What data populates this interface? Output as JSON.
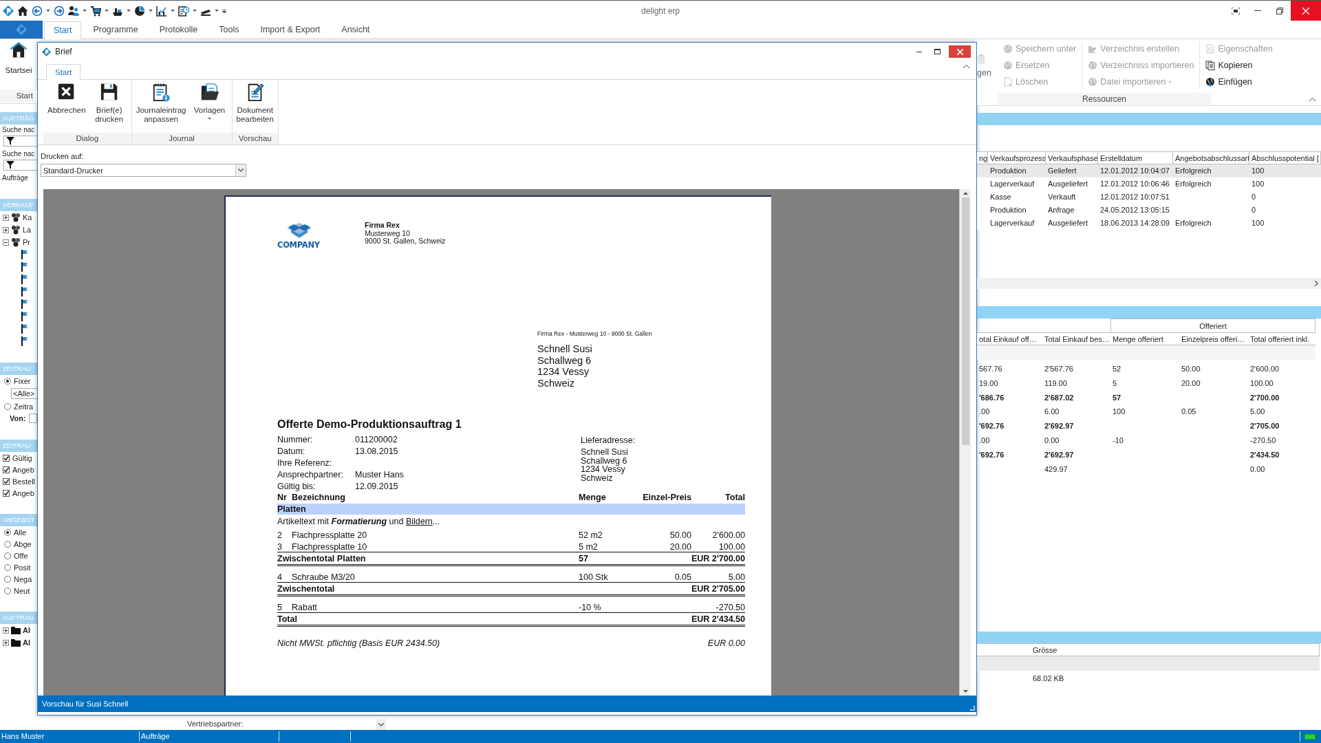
{
  "app": {
    "title": "delight erp"
  },
  "ribbon_tabs": [
    {
      "label": "Start",
      "selected": true
    },
    {
      "label": "Programme",
      "selected": false
    },
    {
      "label": "Protokolle",
      "selected": false
    },
    {
      "label": "Tools",
      "selected": false
    },
    {
      "label": "Import & Export",
      "selected": false
    },
    {
      "label": "Ansicht",
      "selected": false
    }
  ],
  "left_panel": {
    "ribbon_button": "Startsei",
    "ribbon_group": "Start",
    "items": [
      {
        "kind": "header",
        "text": "AUFTRÄG"
      },
      {
        "kind": "label",
        "text": "Suche nac"
      },
      {
        "kind": "filter"
      },
      {
        "kind": "label",
        "text": "Suche nac"
      },
      {
        "kind": "filter"
      },
      {
        "kind": "label",
        "text": "Aufträge"
      },
      {
        "kind": "header",
        "text": "VERKAUF"
      },
      {
        "kind": "tree",
        "text": "Ka",
        "expanded": false
      },
      {
        "kind": "tree",
        "text": "La",
        "expanded": false
      },
      {
        "kind": "tree",
        "text": "Pr",
        "expanded": true,
        "children": [
          {
            "kind": "flag"
          },
          {
            "kind": "flag"
          },
          {
            "kind": "flag"
          },
          {
            "kind": "flag"
          },
          {
            "kind": "flag"
          },
          {
            "kind": "flag"
          },
          {
            "kind": "flag"
          },
          {
            "kind": "flag"
          }
        ]
      },
      {
        "kind": "header",
        "text": "ZEITRAU"
      },
      {
        "kind": "radio",
        "text": "Fixer",
        "selected": true
      },
      {
        "kind": "dropdown",
        "text": "<Alle>"
      },
      {
        "kind": "radio",
        "text": "Zeitra",
        "selected": false
      },
      {
        "kind": "field",
        "text": "Von:"
      },
      {
        "kind": "header",
        "text": "ZEITRAU"
      },
      {
        "kind": "checkbox",
        "text": "Gültig",
        "checked": true
      },
      {
        "kind": "checkbox",
        "text": "Angeb",
        "checked": true
      },
      {
        "kind": "checkbox",
        "text": "Bestell",
        "checked": true
      },
      {
        "kind": "checkbox",
        "text": "Angeb",
        "checked": true
      },
      {
        "kind": "header",
        "text": "ANGEBOT"
      },
      {
        "kind": "radio",
        "text": "Alle",
        "selected": true
      },
      {
        "kind": "radio",
        "text": "Abge",
        "selected": false
      },
      {
        "kind": "radio",
        "text": "Offe",
        "selected": false
      },
      {
        "kind": "radio",
        "text": "Posit",
        "selected": false
      },
      {
        "kind": "radio",
        "text": "Nega",
        "selected": false
      },
      {
        "kind": "radio",
        "text": "Neut",
        "selected": false
      },
      {
        "kind": "header",
        "text": "AUFTRAG"
      },
      {
        "kind": "folder",
        "text": "Al",
        "expanded": false
      },
      {
        "kind": "folder",
        "text": "Al",
        "expanded": false
      }
    ]
  },
  "dialog": {
    "title": "Brief",
    "ribbon_tabs": [
      {
        "label": "Start",
        "selected": true
      }
    ],
    "ribbon_groups": [
      {
        "label": "Dialog",
        "buttons": [
          {
            "kind": "cancel",
            "label": "Abbrechen"
          },
          {
            "kind": "print",
            "label": "Brief(e) drucken"
          }
        ]
      },
      {
        "label": "Journal",
        "buttons": [
          {
            "kind": "journal",
            "label": "Journaleintrag anpassen"
          },
          {
            "kind": "templates",
            "label": "Vorlagen",
            "dropdown": true
          }
        ]
      },
      {
        "label": "Vorschau",
        "buttons": [
          {
            "kind": "edit",
            "label": "Dokument bearbeiten"
          }
        ]
      }
    ],
    "print_target": {
      "label": "Drucken auf:",
      "value": "Standard-Drucker"
    },
    "document": {
      "logo_text": "COMPANY",
      "company": [
        "Firma Rex",
        "Musterweg 10",
        "9000 St. Gallen, Schweiz"
      ],
      "sender_line": "Firma Rex - Musterweg 10 - 9000 St. Gallen",
      "recipient": [
        "Schnell Susi",
        "Schallweg 6",
        "1234 Vessy",
        "Schweiz"
      ],
      "title": "Offerte Demo-Produktionsauftrag 1",
      "meta": [
        {
          "label": "Nummer:",
          "value": "011200002"
        },
        {
          "label": "Datum:",
          "value": "13.08.2015"
        },
        {
          "label": "Ihre Referenz:"
        },
        {
          "label": "Ansprechpartner:",
          "value": "Muster Hans"
        },
        {
          "label": "Gültig bis:",
          "value": "12.09.2015"
        }
      ],
      "delivery": {
        "label": "Lieferadresse:",
        "lines": [
          "Schnell Susi",
          "Schallweg 6",
          "1234 Vessy",
          "Schweiz"
        ]
      },
      "columns": [
        "Nr",
        "Bezeichnung",
        "Menge",
        "Einzel-Preis",
        "Total"
      ],
      "rows": [
        {
          "kind": "group",
          "label": "Platten"
        },
        {
          "kind": "note",
          "text": "Artikeltext mit **Formatierung** und",
          "link": "Bildern",
          "tail": "..."
        },
        {
          "kind": "item",
          "nr": "2",
          "name": "Flachpressplatte 20",
          "qty": "52 m2",
          "price": "50.00",
          "total": "2'600.00"
        },
        {
          "kind": "item",
          "nr": "3",
          "name": "Flachpressplatte 10",
          "qty": "5 m2",
          "price": "20.00",
          "total": "100.00"
        },
        {
          "kind": "subtotal",
          "label": "Zwischentotal Platten",
          "qty": "57",
          "total": "EUR 2'700.00"
        },
        {
          "kind": "item",
          "nr": "4",
          "name": "Schraube M3/20",
          "qty": "100 Stk",
          "price": "0.05",
          "total": "5.00"
        },
        {
          "kind": "subtotal",
          "label": "Zwischentotal",
          "total": "EUR 2'705.00"
        },
        {
          "kind": "item",
          "nr": "5",
          "name": "Rabatt",
          "qty": "-10 %",
          "total": "-270.50"
        },
        {
          "kind": "subtotal",
          "label": "Total",
          "total": "EUR 2'434.50"
        },
        {
          "kind": "tax",
          "text": "Nicht MWSt. pflichtig (Basis EUR 2434.50)",
          "total": "EUR 0.00"
        }
      ]
    },
    "status": "Vorschau für Susi Schnell"
  },
  "background_form": {
    "label": "Vertriebspartner:"
  },
  "right_panel": {
    "resources": {
      "cut_label": "gen",
      "group_label": "Ressourcen",
      "columns": [
        [
          {
            "kind": "globe",
            "label": "Speichern unter",
            "disabled": true
          },
          {
            "kind": "globe",
            "label": "Ersetzen",
            "disabled": true
          },
          {
            "kind": "delete",
            "label": "Löschen",
            "disabled": true
          }
        ],
        [
          {
            "kind": "folder",
            "label": "Verzeichnis erstellen",
            "disabled": true
          },
          {
            "kind": "globe",
            "label": "Verzeichniss importieren",
            "disabled": true
          },
          {
            "kind": "globe",
            "label": "Datei importieren",
            "disabled": true,
            "dropdown": true
          }
        ],
        [
          {
            "kind": "properties",
            "label": "Eigenschaften",
            "disabled": true
          },
          {
            "kind": "copy",
            "label": "Kopieren",
            "disabled": false
          },
          {
            "kind": "paste",
            "label": "Einfügen",
            "disabled": false
          }
        ]
      ]
    },
    "sales_table": {
      "columns": [
        "ng",
        "Verkaufsprozess",
        "Verkaufsphase",
        "Erstelldatum",
        "Angebotsabschlussart",
        "Abschlusspotential ["
      ],
      "rows": [
        {
          "selected": true,
          "cells": [
            null,
            "Produktion",
            "Geliefert",
            "12.01.2012 10:04:07",
            "Erfolgreich",
            "100"
          ]
        },
        {
          "selected": false,
          "cells": [
            null,
            "Lagerverkauf",
            "Ausgeliefert",
            "12.01.2012 10:06:46",
            "Erfolgreich",
            "100"
          ]
        },
        {
          "selected": false,
          "cells": [
            null,
            "Kasse",
            "Verkauft",
            "12.01.2012 10:07:51",
            null,
            "0"
          ]
        },
        {
          "selected": false,
          "cells": [
            null,
            "Produktion",
            "Anfrage",
            "24.05.2012 13:05:15",
            null,
            "0"
          ]
        },
        {
          "selected": false,
          "cells": [
            null,
            "Lagerverkauf",
            "Ausgeliefert",
            "18.06.2013 14:28:09",
            "Erfolgreich",
            "100"
          ]
        }
      ]
    },
    "offer_table": {
      "group": "Offeriert",
      "columns": [
        "otal Einkauf off…",
        "Total Einkauf bes…",
        "Menge offeriert",
        "Einzelpreis offeri…",
        "Total offeriert inkl."
      ],
      "rows": [
        {
          "kind": "item",
          "cells": [
            "567.76",
            "2'567.76",
            "52",
            "50.00",
            "2'600.00"
          ]
        },
        {
          "kind": "item",
          "cells": [
            "19.00",
            "119.00",
            "5",
            "20.00",
            "100.00"
          ]
        },
        {
          "kind": "subtotal",
          "cells": [
            "'686.76",
            "2'687.02",
            "57",
            null,
            "2'700.00"
          ]
        },
        {
          "kind": "item",
          "cells": [
            ".00",
            "6.00",
            "100",
            "0.05",
            "5.00"
          ]
        },
        {
          "kind": "subtotal",
          "cells": [
            "'692.76",
            "2'692.97",
            null,
            null,
            "2'705.00"
          ]
        },
        {
          "kind": "item",
          "cells": [
            ".00",
            "0.00",
            "-10",
            null,
            "-270.50"
          ]
        },
        {
          "kind": "subtotal",
          "cells": [
            "'692.76",
            "2'692.97",
            null,
            null,
            "2'434.50"
          ]
        },
        {
          "kind": "item",
          "cells": [
            null,
            "429.97",
            null,
            null,
            "0.00"
          ]
        }
      ]
    },
    "files_table": {
      "columns": [
        "Grösse"
      ],
      "rows": [
        {
          "cells": [
            "68.02 KB"
          ]
        }
      ]
    }
  },
  "status_bar": {
    "items": [
      "Hans Muster",
      "Aufträge"
    ]
  }
}
